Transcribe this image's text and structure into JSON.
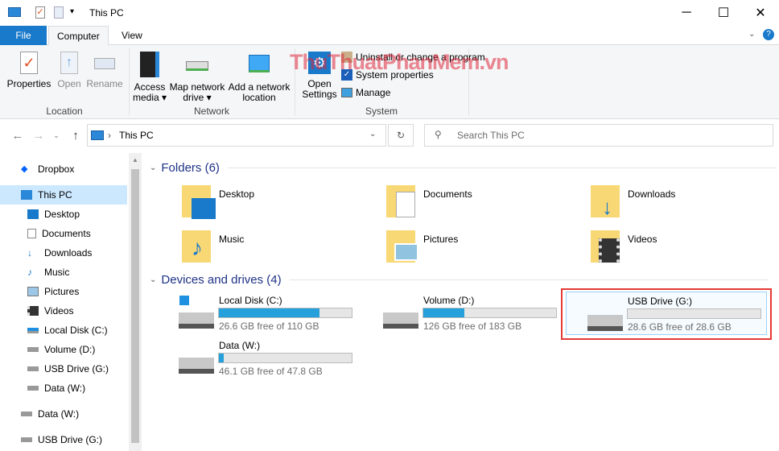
{
  "title": "This PC",
  "window_controls": {
    "minimize": "─",
    "maximize": "☐",
    "close": "✕"
  },
  "tabs": {
    "file": "File",
    "computer": "Computer",
    "view": "View"
  },
  "ribbon": {
    "location": {
      "label": "Location",
      "properties": "Properties",
      "open": "Open",
      "rename": "Rename"
    },
    "network": {
      "label": "Network",
      "access_media": "Access media",
      "map_drive": "Map network drive",
      "add_location": "Add a network location"
    },
    "system": {
      "label": "System",
      "open_settings": "Open Settings",
      "uninstall": "Uninstall or change a program",
      "system_properties": "System properties",
      "manage": "Manage"
    }
  },
  "watermark": "ThuThuatPhanMem.vn",
  "address": {
    "path": "This PC",
    "search_placeholder": "Search This PC"
  },
  "sidebar": {
    "items": [
      {
        "label": "Dropbox",
        "icon": "dropbox-icon"
      },
      {
        "label": "This PC",
        "icon": "pc-icon",
        "selected": true
      },
      {
        "label": "Desktop",
        "icon": "desktop-icon"
      },
      {
        "label": "Documents",
        "icon": "documents-icon"
      },
      {
        "label": "Downloads",
        "icon": "downloads-icon"
      },
      {
        "label": "Music",
        "icon": "music-icon"
      },
      {
        "label": "Pictures",
        "icon": "pictures-icon"
      },
      {
        "label": "Videos",
        "icon": "videos-icon"
      },
      {
        "label": "Local Disk (C:)",
        "icon": "drive-icon"
      },
      {
        "label": "Volume (D:)",
        "icon": "drive-icon"
      },
      {
        "label": "USB Drive (G:)",
        "icon": "drive-icon"
      },
      {
        "label": "Data (W:)",
        "icon": "drive-icon"
      },
      {
        "label": "Data (W:)",
        "icon": "drive-icon"
      },
      {
        "label": "USB Drive (G:)",
        "icon": "drive-icon"
      }
    ]
  },
  "folders": {
    "header": "Folders (6)",
    "items": [
      "Desktop",
      "Documents",
      "Downloads",
      "Music",
      "Pictures",
      "Videos"
    ]
  },
  "drives": {
    "header": "Devices and drives (4)",
    "items": [
      {
        "name": "Local Disk (C:)",
        "free": "26.6 GB free of 110 GB",
        "used_fraction": 0.758
      },
      {
        "name": "Volume (D:)",
        "free": "126 GB free of 183 GB",
        "used_fraction": 0.311
      },
      {
        "name": "USB Drive (G:)",
        "free": "28.6 GB free of 28.6 GB",
        "used_fraction": 0.0
      },
      {
        "name": "Data (W:)",
        "free": "46.1 GB free of 47.8 GB",
        "used_fraction": 0.036
      }
    ]
  },
  "colors": {
    "accent": "#1979ca",
    "bar": "#26a0da",
    "highlight": "#e53935"
  }
}
